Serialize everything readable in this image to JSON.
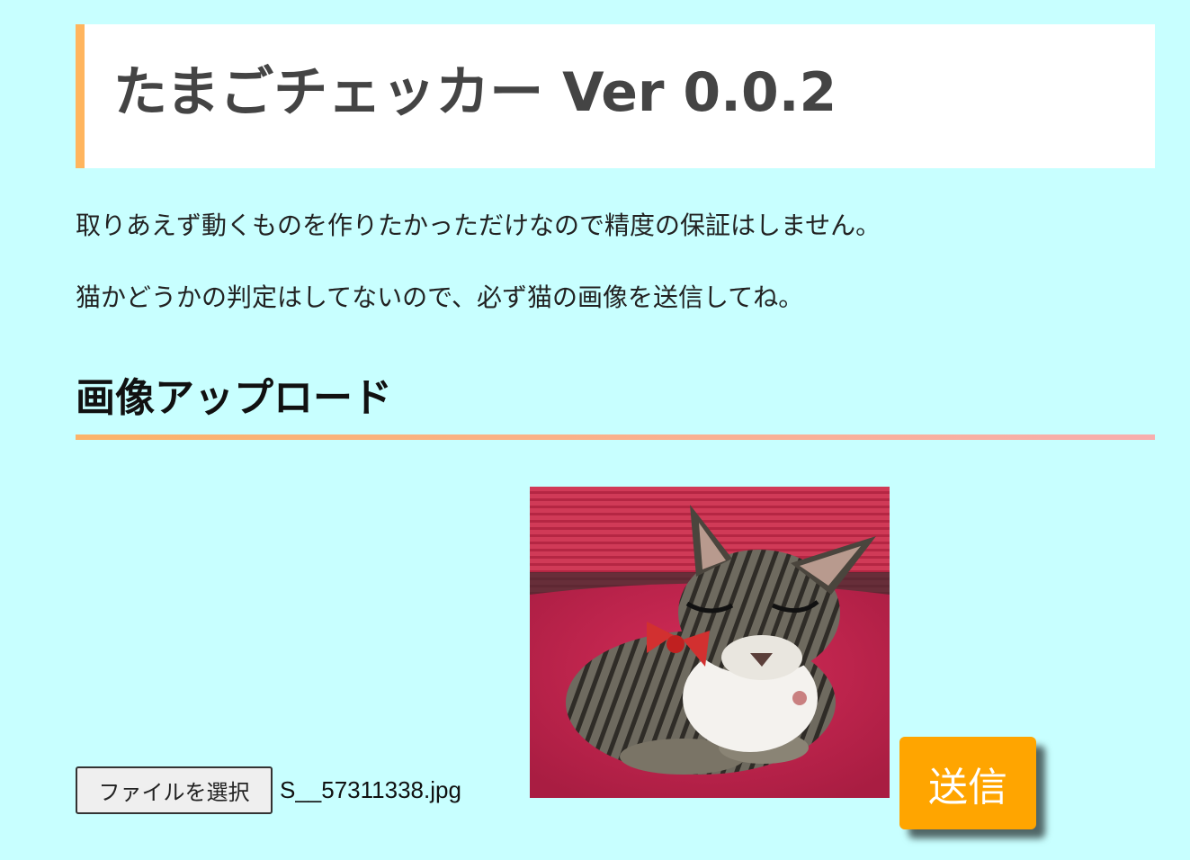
{
  "header": {
    "title": "たまごチェッカー Ver 0.0.2",
    "accent_color": "#ffb55e"
  },
  "intro": {
    "line1": "取りあえず動くものを作りたかっただけなので精度の保証はしません。",
    "line2": "猫かどうかの判定はしてないので、必ず猫の画像を送信してね。"
  },
  "upload": {
    "heading": "画像アップロード",
    "file_button_label": "ファイルを選択",
    "file_name": "S__57311338.jpg",
    "preview_icon": "cat-photo",
    "submit_label": "送信",
    "submit_color": "#ffa500"
  },
  "colors": {
    "background": "#c8ffff"
  }
}
